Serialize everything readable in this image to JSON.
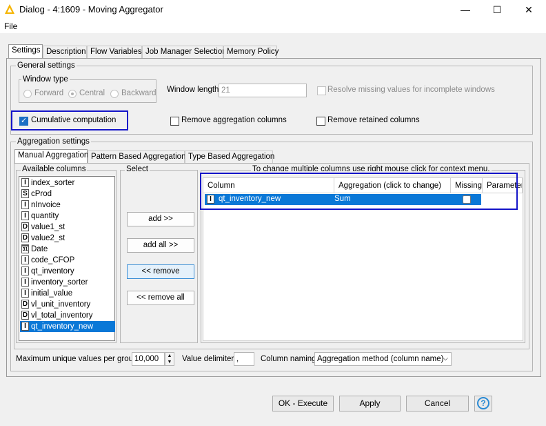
{
  "window": {
    "title": "Dialog - 4:1609 - Moving Aggregator",
    "minimize_glyph": "—",
    "maximize_glyph": "☐",
    "close_glyph": "✕"
  },
  "menu": {
    "file": "File"
  },
  "tabs": [
    "Settings",
    "Description",
    "Flow Variables",
    "Job Manager Selection",
    "Memory Policy"
  ],
  "general": {
    "label": "General settings",
    "window_type_label": "Window type",
    "radios": [
      "Forward",
      "Central",
      "Backward"
    ],
    "window_length_label": "Window length",
    "window_length_value": "21",
    "resolve_missing_label": "Resolve missing values for incomplete windows",
    "cumulative_label": "Cumulative computation",
    "remove_agg_label": "Remove aggregation columns",
    "remove_retained_label": "Remove retained columns"
  },
  "aggregation": {
    "label": "Aggregation settings",
    "subtabs": [
      "Manual Aggregation",
      "Pattern Based Aggregation",
      "Type Based Aggregation"
    ],
    "available_label": "Available columns",
    "select_label": "Select",
    "hint": "To change multiple columns use right mouse click for context menu.",
    "columns": [
      {
        "type": "I",
        "name": "index_sorter"
      },
      {
        "type": "S",
        "name": "cProd"
      },
      {
        "type": "I",
        "name": "nInvoice"
      },
      {
        "type": "I",
        "name": "quantity"
      },
      {
        "type": "D",
        "name": "value1_st"
      },
      {
        "type": "D",
        "name": "value2_st"
      },
      {
        "type": "31",
        "name": "Date"
      },
      {
        "type": "I",
        "name": "code_CFOP"
      },
      {
        "type": "I",
        "name": "qt_inventory"
      },
      {
        "type": "I",
        "name": "inventory_sorter"
      },
      {
        "type": "I",
        "name": "initial_value"
      },
      {
        "type": "D",
        "name": "vl_unit_inventory"
      },
      {
        "type": "D",
        "name": "vl_total_inventory"
      },
      {
        "type": "I",
        "name": "qt_inventory_new"
      }
    ],
    "buttons": [
      "add >>",
      "add all >>",
      "<< remove",
      "<< remove all"
    ],
    "table_headers": [
      "Column",
      "Aggregation (click to change)",
      "Missing",
      "Parameter"
    ],
    "table_row": {
      "type": "I",
      "column": "qt_inventory_new",
      "aggregation": "Sum"
    }
  },
  "bottom": {
    "max_unique_label": "Maximum unique values per group",
    "max_unique_value": "10,000",
    "value_delim_label": "Value delimiter",
    "value_delim_value": ",",
    "column_naming_label": "Column naming",
    "column_naming_value": "Aggregation method (column name)"
  },
  "footer": {
    "ok": "OK - Execute",
    "apply": "Apply",
    "cancel": "Cancel",
    "help": "?"
  },
  "colors": {
    "accent": "#0a78d7",
    "highlight_box": "#1414c8"
  }
}
